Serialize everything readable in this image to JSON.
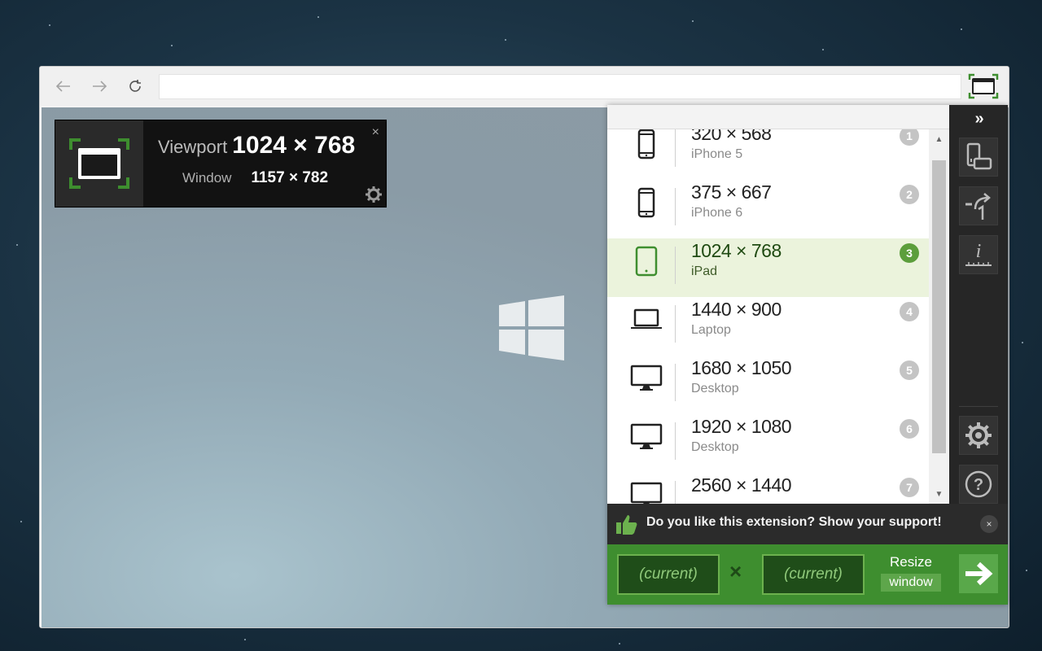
{
  "browser": {
    "back_icon": "back-arrow-icon",
    "forward_icon": "forward-arrow-icon",
    "reload_icon": "reload-icon",
    "address_value": "",
    "extension_icon": "window-resizer-icon"
  },
  "overlay": {
    "viewport_label": "Viewport",
    "viewport_value": "1024 × 768",
    "window_label": "Window",
    "window_value": "1157 × 782",
    "close": "×"
  },
  "presets": [
    {
      "size": "320 × 568",
      "name": "iPhone 5",
      "num": "1",
      "icon": "phone-icon",
      "active": false
    },
    {
      "size": "375 × 667",
      "name": "iPhone 6",
      "num": "2",
      "icon": "phone-icon",
      "active": false
    },
    {
      "size": "1024 × 768",
      "name": "iPad",
      "num": "3",
      "icon": "tablet-icon",
      "active": true
    },
    {
      "size": "1440 × 900",
      "name": "Laptop",
      "num": "4",
      "icon": "laptop-icon",
      "active": false
    },
    {
      "size": "1680 × 1050",
      "name": "Desktop",
      "num": "5",
      "icon": "desktop-icon",
      "active": false
    },
    {
      "size": "1920 × 1080",
      "name": "Desktop",
      "num": "6",
      "icon": "desktop-icon",
      "active": false
    },
    {
      "size": "2560 × 1440",
      "name": "",
      "num": "7",
      "icon": "desktop-icon",
      "active": false
    }
  ],
  "sidebar": {
    "collapse": "»",
    "buttons": [
      "rotate-viewport-icon",
      "presets-shortcut-icon",
      "viewport-info-icon",
      "settings-gear-icon",
      "help-icon"
    ]
  },
  "support": {
    "text": "Do you like this extension? Show your support!",
    "close": "×"
  },
  "resize": {
    "width_placeholder": "(current)",
    "height_placeholder": "(current)",
    "times": "×",
    "label_line1": "Resize",
    "label_line2": "window"
  },
  "colors": {
    "accent_green": "#3e8e2f",
    "active_row": "#ebf3dc",
    "dark_panel": "#262626"
  }
}
